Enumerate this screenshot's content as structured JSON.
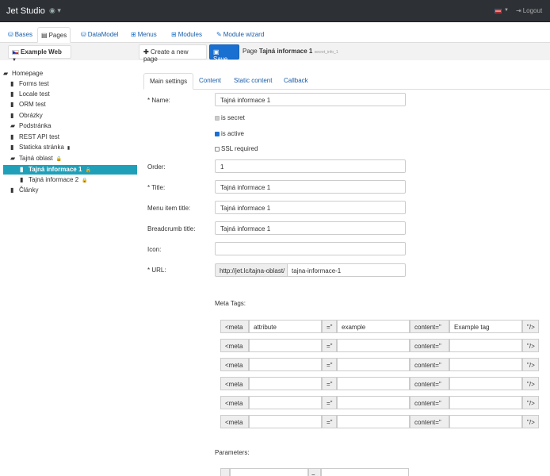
{
  "app": {
    "brand": "Jet Studio",
    "eye_icon": "eye-icon",
    "logout": "Logout"
  },
  "nav": {
    "tabs": [
      {
        "label": "Bases",
        "icon": "database-icon"
      },
      {
        "label": "Pages",
        "icon": "file-icon",
        "active": true
      },
      {
        "label": "DataModel",
        "icon": "database-icon"
      },
      {
        "label": "Menus",
        "icon": "sitemap-icon"
      },
      {
        "label": "Modules",
        "icon": "sitemap-icon"
      },
      {
        "label": "Module wizard",
        "icon": "wand-icon"
      }
    ]
  },
  "toolbar": {
    "site": "Example Web",
    "new_page": "Create a new page",
    "save": "Save",
    "page_prefix": "Page",
    "page_name": "Tajná informace 1",
    "page_id": "secret_info_1"
  },
  "tree": [
    {
      "label": "Homepage",
      "icon": "folder-open-icon",
      "level": 0
    },
    {
      "label": "Forms test",
      "icon": "file-icon",
      "level": 1
    },
    {
      "label": "Locale test",
      "icon": "file-icon",
      "level": 1
    },
    {
      "label": "ORM test",
      "icon": "file-icon",
      "level": 1
    },
    {
      "label": "Obrázky",
      "icon": "file-icon",
      "level": 1
    },
    {
      "label": "Podstránka",
      "icon": "folder-icon",
      "level": 1
    },
    {
      "label": "REST API test",
      "icon": "file-icon",
      "level": 1
    },
    {
      "label": "Staticka stránka",
      "icon": "file-icon",
      "level": 1,
      "badge": "file-icon"
    },
    {
      "label": "Tajná oblast",
      "icon": "folder-open-icon",
      "level": 1,
      "badge": "lock-icon"
    },
    {
      "label": "Tajná informace 1",
      "icon": "file-icon",
      "level": 2,
      "badge": "lock-icon",
      "selected": true
    },
    {
      "label": "Tajná informace 2",
      "icon": "file-icon",
      "level": 2,
      "badge": "lock-icon"
    },
    {
      "label": "Články",
      "icon": "file-icon",
      "level": 1
    }
  ],
  "content_tabs": [
    {
      "label": "Main settings",
      "active": true
    },
    {
      "label": "Content"
    },
    {
      "label": "Static content"
    },
    {
      "label": "Callback"
    }
  ],
  "form": {
    "name_label": "* Name:",
    "name_value": "Tajná informace 1",
    "is_secret": "is secret",
    "is_active": "is active",
    "ssl_required": "SSL required",
    "order_label": "Order:",
    "order_value": "1",
    "title_label": "* Title:",
    "title_value": "Tajná informace 1",
    "menu_title_label": "Menu item title:",
    "menu_title_value": "Tajná informace 1",
    "breadcrumb_label": "Breadcrumb title:",
    "breadcrumb_value": "Tajná informace 1",
    "icon_label": "Icon:",
    "icon_value": "",
    "url_label": "* URL:",
    "url_prefix": "http://jet.lc/tajna-oblast/",
    "url_value": "tajna-informace-1",
    "checks": {
      "is_secret": false,
      "is_active": true,
      "ssl_required": false
    }
  },
  "meta": {
    "title": "Meta Tags:",
    "open": "<meta",
    "eq": "=\"",
    "content": "content=\"",
    "close": "\"/>",
    "rows": [
      {
        "attribute": "attribute",
        "value": "example",
        "content": "Example tag"
      },
      {
        "attribute": "",
        "value": "",
        "content": ""
      },
      {
        "attribute": "",
        "value": "",
        "content": ""
      },
      {
        "attribute": "",
        "value": "",
        "content": ""
      },
      {
        "attribute": "",
        "value": "",
        "content": ""
      },
      {
        "attribute": "",
        "value": "",
        "content": ""
      }
    ]
  },
  "parameters": {
    "title": "Parameters:",
    "eq": "="
  },
  "colors": {
    "topbar": "#2d3136",
    "accent": "#1a70d0",
    "selected": "#1fa0b8"
  }
}
